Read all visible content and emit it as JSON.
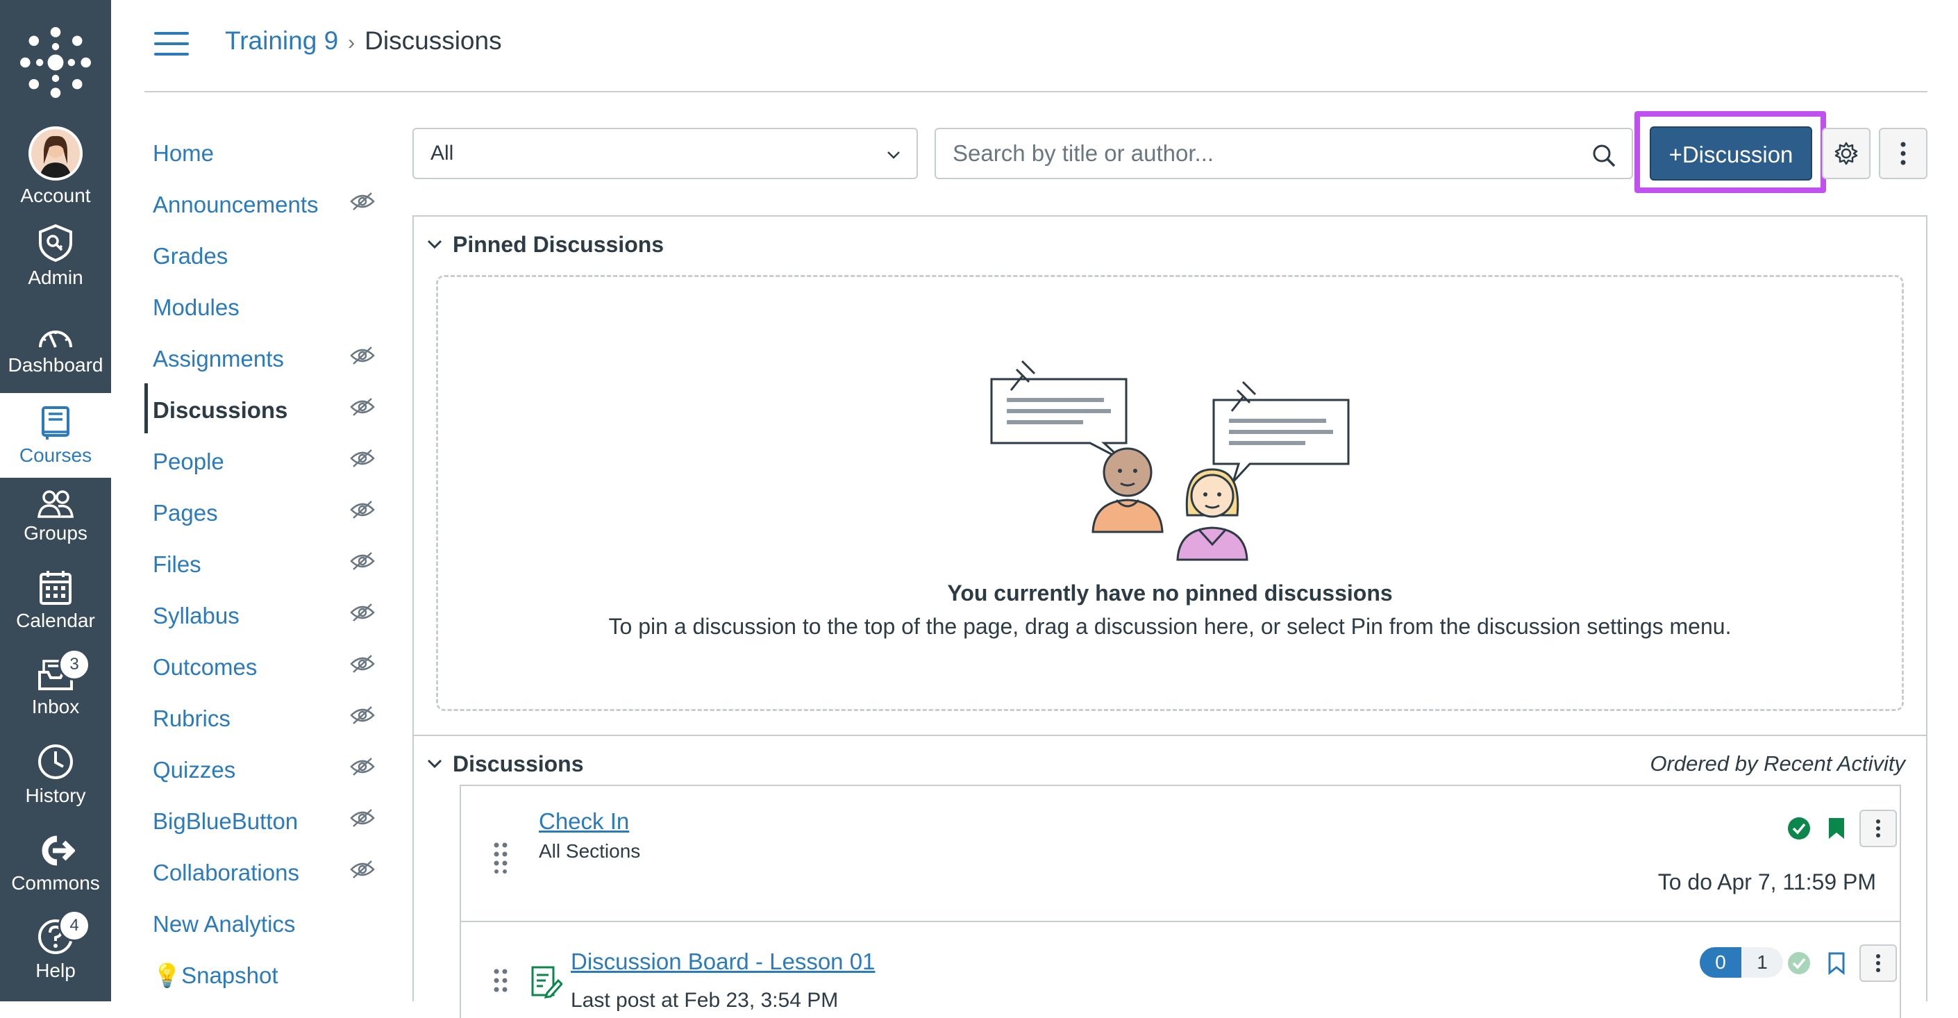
{
  "global_nav": {
    "items": [
      {
        "label": "Account",
        "icon": "avatar"
      },
      {
        "label": "Admin",
        "icon": "shield-icon"
      },
      {
        "label": "Dashboard",
        "icon": "speedometer-icon"
      },
      {
        "label": "Courses",
        "icon": "book-icon"
      },
      {
        "label": "Groups",
        "icon": "people-icon"
      },
      {
        "label": "Calendar",
        "icon": "calendar-icon"
      },
      {
        "label": "Inbox",
        "icon": "inbox-icon",
        "badge": "3"
      },
      {
        "label": "History",
        "icon": "clock-icon"
      },
      {
        "label": "Commons",
        "icon": "commons-icon"
      },
      {
        "label": "Help",
        "icon": "help-icon",
        "badge": "4"
      }
    ],
    "active": "Courses"
  },
  "breadcrumb": {
    "course": "Training 9",
    "separator": "›",
    "current": "Discussions"
  },
  "course_nav": {
    "items": [
      {
        "label": "Home",
        "hidden": false
      },
      {
        "label": "Announcements",
        "hidden": true
      },
      {
        "label": "Grades",
        "hidden": false
      },
      {
        "label": "Modules",
        "hidden": false
      },
      {
        "label": "Assignments",
        "hidden": true
      },
      {
        "label": "Discussions",
        "hidden": true,
        "active": true
      },
      {
        "label": "People",
        "hidden": true
      },
      {
        "label": "Pages",
        "hidden": true
      },
      {
        "label": "Files",
        "hidden": true
      },
      {
        "label": "Syllabus",
        "hidden": true
      },
      {
        "label": "Outcomes",
        "hidden": true
      },
      {
        "label": "Rubrics",
        "hidden": true
      },
      {
        "label": "Quizzes",
        "hidden": true
      },
      {
        "label": "BigBlueButton",
        "hidden": true
      },
      {
        "label": "Collaborations",
        "hidden": true
      },
      {
        "label": "New Analytics",
        "hidden": false
      },
      {
        "label": "💡Snapshot",
        "hidden": false
      }
    ]
  },
  "toolbar": {
    "filter_value": "All",
    "search_placeholder": "Search by title or author...",
    "add_label": "+Discussion"
  },
  "pinned": {
    "title": "Pinned Discussions",
    "empty_title": "You currently have no pinned discussions",
    "empty_desc": "To pin a discussion to the top of the page, drag a discussion here, or select Pin from the discussion settings menu."
  },
  "discussions": {
    "title": "Discussions",
    "order_label": "Ordered by Recent Activity",
    "items": [
      {
        "title": "Check In",
        "sub": "All Sections",
        "due": "To do Apr 7, 11:59 PM"
      },
      {
        "title": "Discussion Board - Lesson 01",
        "sub": "Last post at Feb 23, 3:54 PM",
        "unread": "0",
        "total": "1"
      }
    ]
  },
  "colors": {
    "nav_bg": "#394b58",
    "link": "#2b7abc",
    "primary_btn": "#2d5d8a",
    "highlight": "#c050f0",
    "success": "#0b874b"
  }
}
